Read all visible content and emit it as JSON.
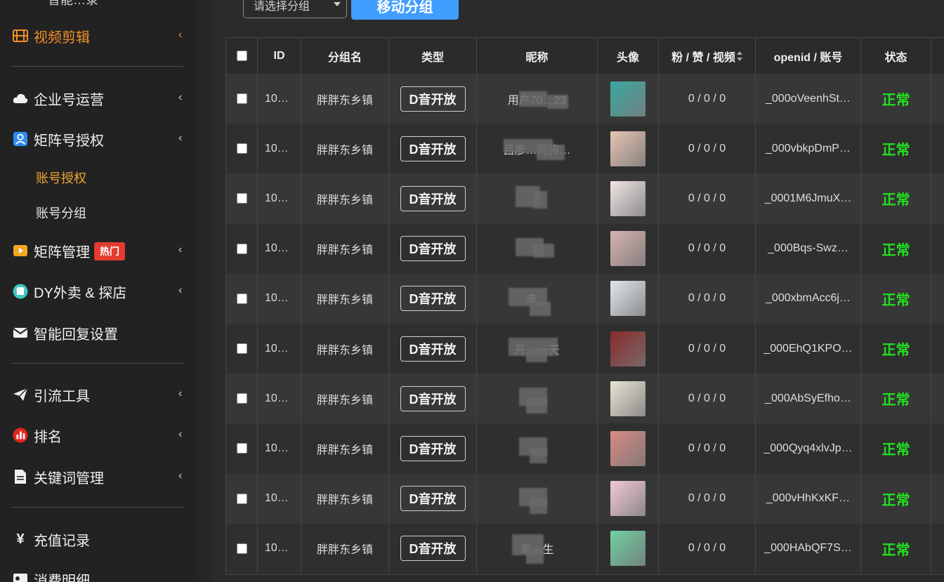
{
  "sidebar": {
    "top_partial": "智能…录",
    "video_edit": "视频剪辑",
    "enterprise": "企业号运营",
    "matrix_auth": "矩阵号授权",
    "account_auth": "账号授权",
    "account_group": "账号分组",
    "matrix_manage": "矩阵管理",
    "hot_badge": "热门",
    "dy_takeout": "DY外卖 & 探店",
    "smart_reply": "智能回复设置",
    "traffic_tools": "引流工具",
    "ranking": "排名",
    "keywords": "关键词管理",
    "recharge": "充值记录",
    "consumption": "消费明细",
    "chevron": "‹"
  },
  "toolbar": {
    "select_placeholder": "请选择分组",
    "move_button": "移动分组"
  },
  "table": {
    "headers": {
      "id": "ID",
      "group": "分组名",
      "type": "类型",
      "nickname": "昵称",
      "avatar": "头像",
      "stats": "粉 / 赞 / 视频",
      "openid": "openid / 账号",
      "status": "状态"
    },
    "rows": [
      {
        "id": "10…",
        "group": "胖胖东乡镇",
        "type": "D音开放",
        "nickname": "用户70…23",
        "stats": "0 / 0 / 0",
        "openid": "_000oVeenhSt…",
        "status": "正常",
        "avatar_color": "#3aa8a0"
      },
      {
        "id": "10…",
        "group": "胖胖东乡镇",
        "type": "D音开放",
        "nickname": "吕彦…阿弥…",
        "stats": "0 / 0 / 0",
        "openid": "_000vbkpDmP…",
        "status": "正常",
        "avatar_color": "#e8c4b4"
      },
      {
        "id": "10…",
        "group": "胖胖东乡镇",
        "type": "D音开放",
        "nickname": "",
        "stats": "0 / 0 / 0",
        "openid": "_0001M6JmuX…",
        "status": "正常",
        "avatar_color": "#f2e6e6"
      },
      {
        "id": "10…",
        "group": "胖胖东乡镇",
        "type": "D音开放",
        "nickname": "",
        "stats": "0 / 0 / 0",
        "openid": "_000Bqs-Swz…",
        "status": "正常",
        "avatar_color": "#d9b4b0"
      },
      {
        "id": "10…",
        "group": "胖胖东乡镇",
        "type": "D音开放",
        "nickname": "幸…",
        "stats": "0 / 0 / 0",
        "openid": "_000xbmAcc6j…",
        "status": "正常",
        "avatar_color": "#dfe8ee"
      },
      {
        "id": "10…",
        "group": "胖胖东乡镇",
        "type": "D音开放",
        "nickname": "开…一天",
        "stats": "0 / 0 / 0",
        "openid": "_000EhQ1KPO…",
        "status": "正常",
        "avatar_color": "#8a2a2a"
      },
      {
        "id": "10…",
        "group": "胖胖东乡镇",
        "type": "D音开放",
        "nickname": "",
        "stats": "0 / 0 / 0",
        "openid": "_000AbSyEfho…",
        "status": "正常",
        "avatar_color": "#e9e4d4"
      },
      {
        "id": "10…",
        "group": "胖胖东乡镇",
        "type": "D音开放",
        "nickname": "",
        "stats": "0 / 0 / 0",
        "openid": "_000Qyq4xlvJp…",
        "status": "正常",
        "avatar_color": "#d98a84"
      },
      {
        "id": "10…",
        "group": "胖胖东乡镇",
        "type": "D音开放",
        "nickname": "",
        "stats": "0 / 0 / 0",
        "openid": "_000vHhKxKF…",
        "status": "正常",
        "avatar_color": "#f3c9d6"
      },
      {
        "id": "10…",
        "group": "胖胖东乡镇",
        "type": "D音开放",
        "nickname": "幸…生",
        "stats": "0 / 0 / 0",
        "openid": "_000HAbQF7S…",
        "status": "正常",
        "avatar_color": "#6fd0a2"
      }
    ]
  }
}
